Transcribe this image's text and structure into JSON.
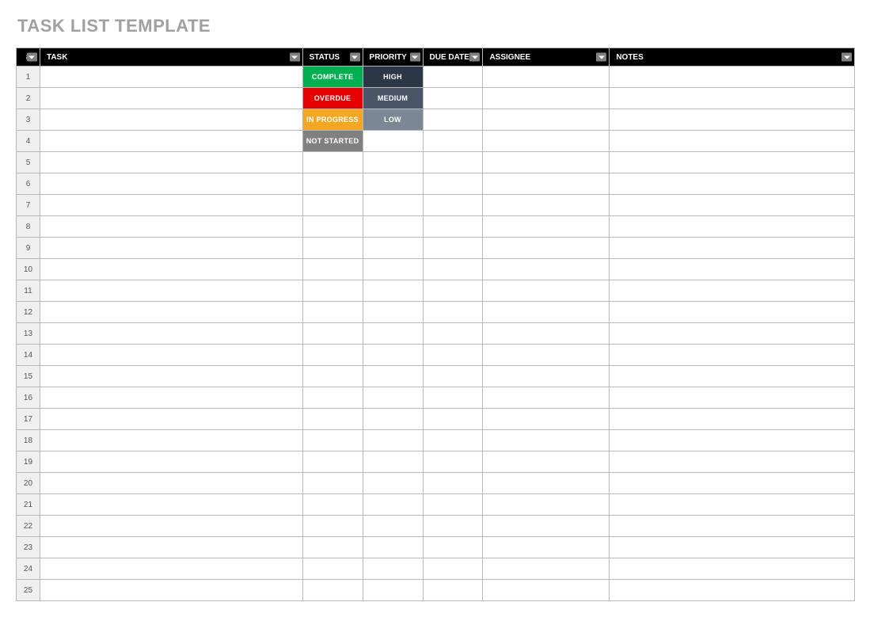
{
  "title": "TASK LIST TEMPLATE",
  "columns": {
    "num": "#",
    "task": "TASK",
    "status": "STATUS",
    "priority": "PRIORITY",
    "due": "DUE DATE",
    "assignee": "ASSIGNEE",
    "notes": "NOTES"
  },
  "status_options": {
    "complete": {
      "label": "COMPLETE",
      "cls": "bg-complete"
    },
    "overdue": {
      "label": "OVERDUE",
      "cls": "bg-overdue"
    },
    "inprogress": {
      "label": "IN PROGRESS",
      "cls": "bg-inprogress"
    },
    "notstarted": {
      "label": "NOT STARTED",
      "cls": "bg-notstarted"
    }
  },
  "priority_options": {
    "high": {
      "label": "HIGH",
      "cls": "bg-high"
    },
    "medium": {
      "label": "MEDIUM",
      "cls": "bg-medium"
    },
    "low": {
      "label": "LOW",
      "cls": "bg-low"
    }
  },
  "rows": [
    {
      "n": "1",
      "task": "",
      "status": "complete",
      "priority": "high",
      "due": "",
      "assignee": "",
      "notes": ""
    },
    {
      "n": "2",
      "task": "",
      "status": "overdue",
      "priority": "medium",
      "due": "",
      "assignee": "",
      "notes": ""
    },
    {
      "n": "3",
      "task": "",
      "status": "inprogress",
      "priority": "low",
      "due": "",
      "assignee": "",
      "notes": ""
    },
    {
      "n": "4",
      "task": "",
      "status": "notstarted",
      "priority": "",
      "due": "",
      "assignee": "",
      "notes": ""
    },
    {
      "n": "5",
      "task": "",
      "status": "",
      "priority": "",
      "due": "",
      "assignee": "",
      "notes": ""
    },
    {
      "n": "6",
      "task": "",
      "status": "",
      "priority": "",
      "due": "",
      "assignee": "",
      "notes": ""
    },
    {
      "n": "7",
      "task": "",
      "status": "",
      "priority": "",
      "due": "",
      "assignee": "",
      "notes": ""
    },
    {
      "n": "8",
      "task": "",
      "status": "",
      "priority": "",
      "due": "",
      "assignee": "",
      "notes": ""
    },
    {
      "n": "9",
      "task": "",
      "status": "",
      "priority": "",
      "due": "",
      "assignee": "",
      "notes": ""
    },
    {
      "n": "10",
      "task": "",
      "status": "",
      "priority": "",
      "due": "",
      "assignee": "",
      "notes": ""
    },
    {
      "n": "11",
      "task": "",
      "status": "",
      "priority": "",
      "due": "",
      "assignee": "",
      "notes": ""
    },
    {
      "n": "12",
      "task": "",
      "status": "",
      "priority": "",
      "due": "",
      "assignee": "",
      "notes": ""
    },
    {
      "n": "13",
      "task": "",
      "status": "",
      "priority": "",
      "due": "",
      "assignee": "",
      "notes": ""
    },
    {
      "n": "14",
      "task": "",
      "status": "",
      "priority": "",
      "due": "",
      "assignee": "",
      "notes": ""
    },
    {
      "n": "15",
      "task": "",
      "status": "",
      "priority": "",
      "due": "",
      "assignee": "",
      "notes": ""
    },
    {
      "n": "16",
      "task": "",
      "status": "",
      "priority": "",
      "due": "",
      "assignee": "",
      "notes": ""
    },
    {
      "n": "17",
      "task": "",
      "status": "",
      "priority": "",
      "due": "",
      "assignee": "",
      "notes": ""
    },
    {
      "n": "18",
      "task": "",
      "status": "",
      "priority": "",
      "due": "",
      "assignee": "",
      "notes": ""
    },
    {
      "n": "19",
      "task": "",
      "status": "",
      "priority": "",
      "due": "",
      "assignee": "",
      "notes": ""
    },
    {
      "n": "20",
      "task": "",
      "status": "",
      "priority": "",
      "due": "",
      "assignee": "",
      "notes": ""
    },
    {
      "n": "21",
      "task": "",
      "status": "",
      "priority": "",
      "due": "",
      "assignee": "",
      "notes": ""
    },
    {
      "n": "22",
      "task": "",
      "status": "",
      "priority": "",
      "due": "",
      "assignee": "",
      "notes": ""
    },
    {
      "n": "23",
      "task": "",
      "status": "",
      "priority": "",
      "due": "",
      "assignee": "",
      "notes": ""
    },
    {
      "n": "24",
      "task": "",
      "status": "",
      "priority": "",
      "due": "",
      "assignee": "",
      "notes": ""
    },
    {
      "n": "25",
      "task": "",
      "status": "",
      "priority": "",
      "due": "",
      "assignee": "",
      "notes": ""
    }
  ]
}
